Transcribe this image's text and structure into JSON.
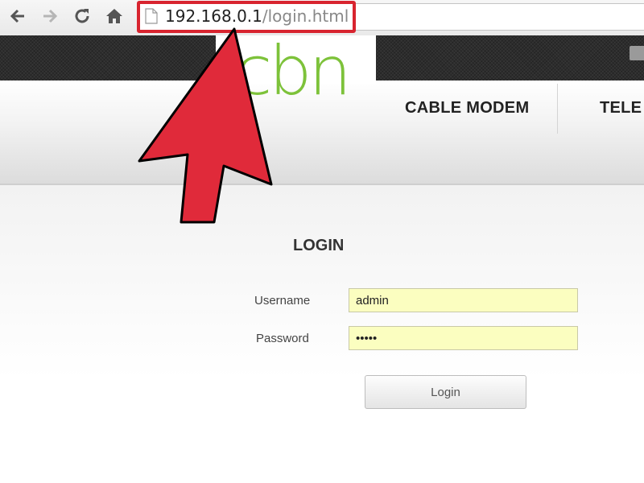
{
  "browser": {
    "url_host": "192.168.0.1",
    "url_path": "/login.html",
    "nav_icons": [
      "back-arrow-icon",
      "forward-arrow-icon",
      "reload-icon",
      "home-icon"
    ]
  },
  "header": {
    "logo_text": "cbn",
    "nav": [
      "CABLE MODEM",
      "TELE"
    ]
  },
  "login": {
    "title": "LOGIN",
    "username_label": "Username",
    "username_value": "admin",
    "password_label": "Password",
    "password_value": "•••••",
    "button_label": "Login"
  },
  "colors": {
    "logo_green": "#7dc23a",
    "highlight_red": "#d8242f",
    "input_fill": "#fbfec0"
  }
}
